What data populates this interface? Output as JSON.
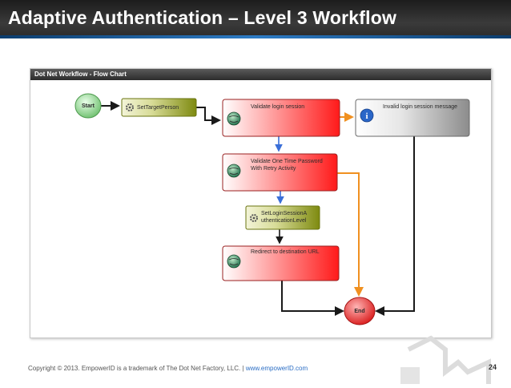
{
  "slide": {
    "title": "Adaptive Authentication – Level 3 Workflow",
    "page_number": "24"
  },
  "window": {
    "title": "Dot Net Workflow - Flow Chart"
  },
  "nodes": {
    "start": "Start",
    "set_target_person": "SetTargetPerson",
    "validate_login_session": "Validate login session",
    "invalid_login_message": "Invalid login session message",
    "validate_otp_line1": "Validate One Time Password",
    "validate_otp_line2": "With Retry Activity",
    "set_login_level_line1": "SetLoginSessionA",
    "set_login_level_line2": "uthenticationLevel",
    "redirect": "Redirect to destination URL",
    "end": "End"
  },
  "footer": {
    "copyright": "Copyright © 2013. EmpowerID is a trademark of The Dot Net Factory, LLC.",
    "separator": "|",
    "link": "www.empowerID.com"
  },
  "colors": {
    "activity_red": "#ff2020",
    "activity_gray": "#a8a8a8",
    "olive_green": "#8a9a20",
    "start_green": "#8ed08e",
    "end_red": "#ee2a2a",
    "arrow_orange": "#f09020",
    "arrow_blue": "#3a6fd8"
  }
}
